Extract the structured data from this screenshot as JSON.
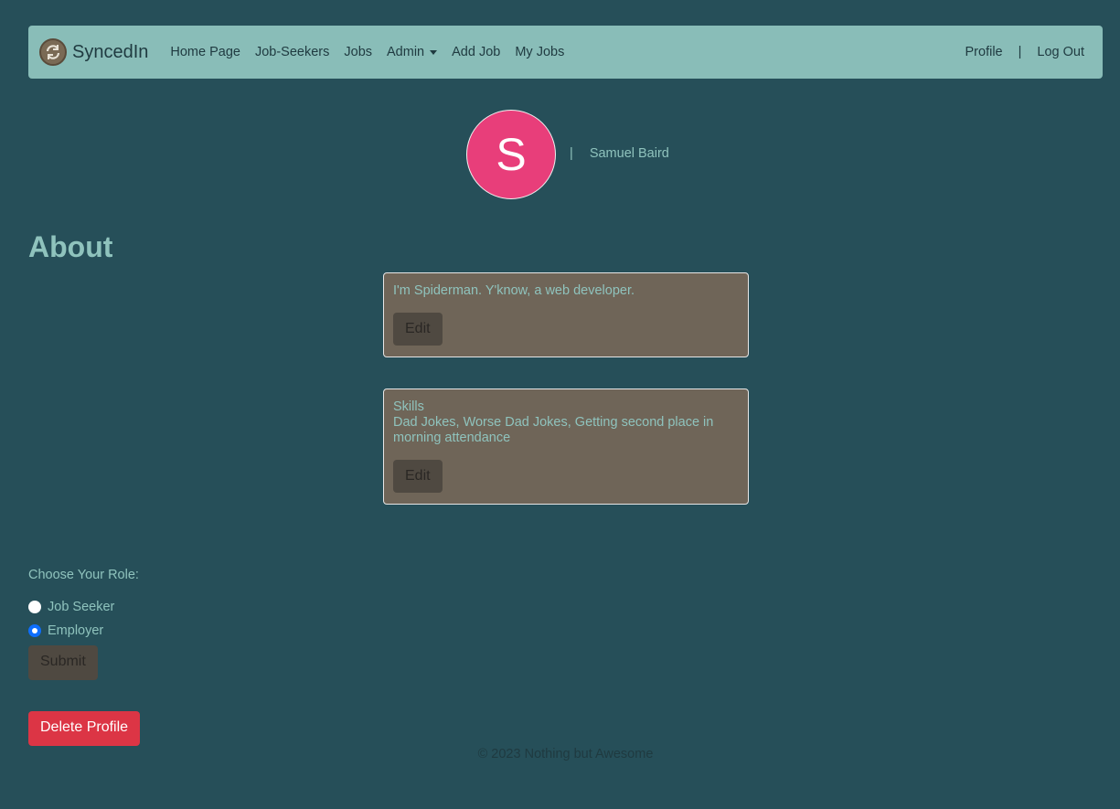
{
  "navbar": {
    "brand": "SyncedIn",
    "brand_icon": "sync-icon",
    "links": [
      "Home Page",
      "Job-Seekers",
      "Jobs",
      "Admin",
      "Add Job",
      "My Jobs"
    ],
    "right": {
      "profile": "Profile",
      "separator": "|",
      "logout": "Log Out"
    }
  },
  "profile": {
    "avatar_letter": "S",
    "separator": "|",
    "name": "Samuel Baird",
    "avatar_color": "#e83e7a"
  },
  "about": {
    "title": "About",
    "text": "I'm Spiderman. Y'know, a web developer.",
    "edit_label": "Edit"
  },
  "skills": {
    "heading": "Skills",
    "text": "Dad Jokes, Worse Dad Jokes, Getting second place in morning attendance",
    "edit_label": "Edit"
  },
  "role": {
    "label": "Choose Your Role:",
    "options": [
      {
        "label": "Job Seeker",
        "checked": false
      },
      {
        "label": "Employer",
        "checked": true
      }
    ],
    "submit_label": "Submit"
  },
  "delete_label": "Delete Profile",
  "footer": "© 2023 Nothing but Awesome",
  "colors": {
    "background": "#264f59",
    "navbar": "#89bdb8",
    "card": "#6f6558",
    "danger": "#dc3545"
  }
}
